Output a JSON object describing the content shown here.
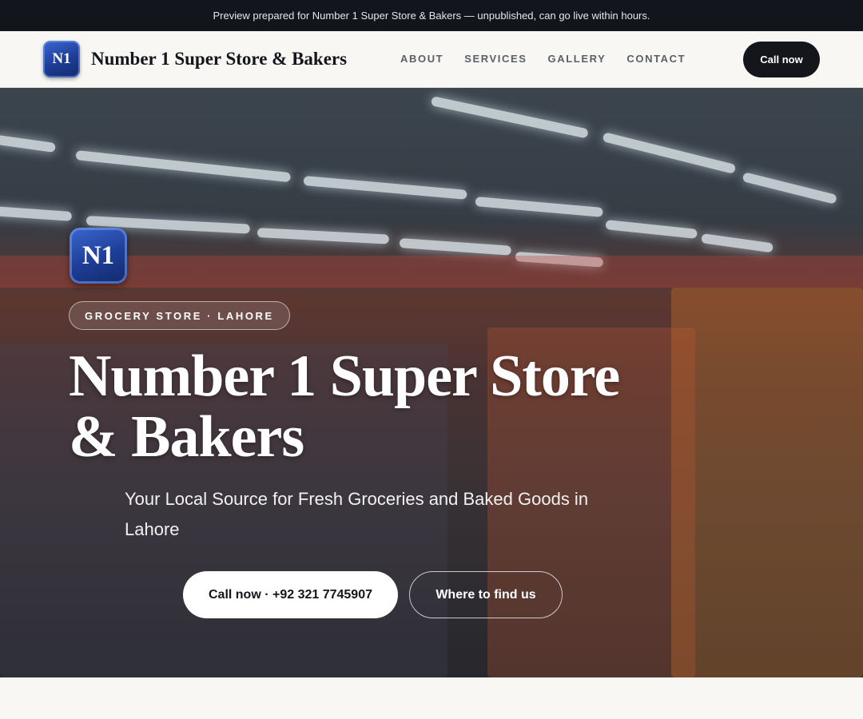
{
  "preview_bar": {
    "text": "Preview prepared for Number 1 Super Store & Bakers — unpublished, can go live within hours."
  },
  "header": {
    "logo_text": "N1",
    "brand_name": "Number 1 Super Store & Bakers",
    "nav": [
      {
        "label": "ABOUT"
      },
      {
        "label": "SERVICES"
      },
      {
        "label": "GALLERY"
      },
      {
        "label": "CONTACT"
      }
    ],
    "call_label": "Call now"
  },
  "hero": {
    "logo_text": "N1",
    "tag": "GROCERY STORE · LAHORE",
    "title": "Number 1 Super Store & Bakers",
    "subtitle": "Your Local Source for Fresh Groceries and Baked Goods in Lahore",
    "primary_button": "Call now · +92 321 7745907",
    "secondary_button": "Where to find us",
    "background": "store-aisle-photo"
  },
  "colors": {
    "dark": "#14161b",
    "preview_bg": "#12151c",
    "page_bg": "#f8f7f4",
    "logo_blue": "#1d3d96"
  }
}
